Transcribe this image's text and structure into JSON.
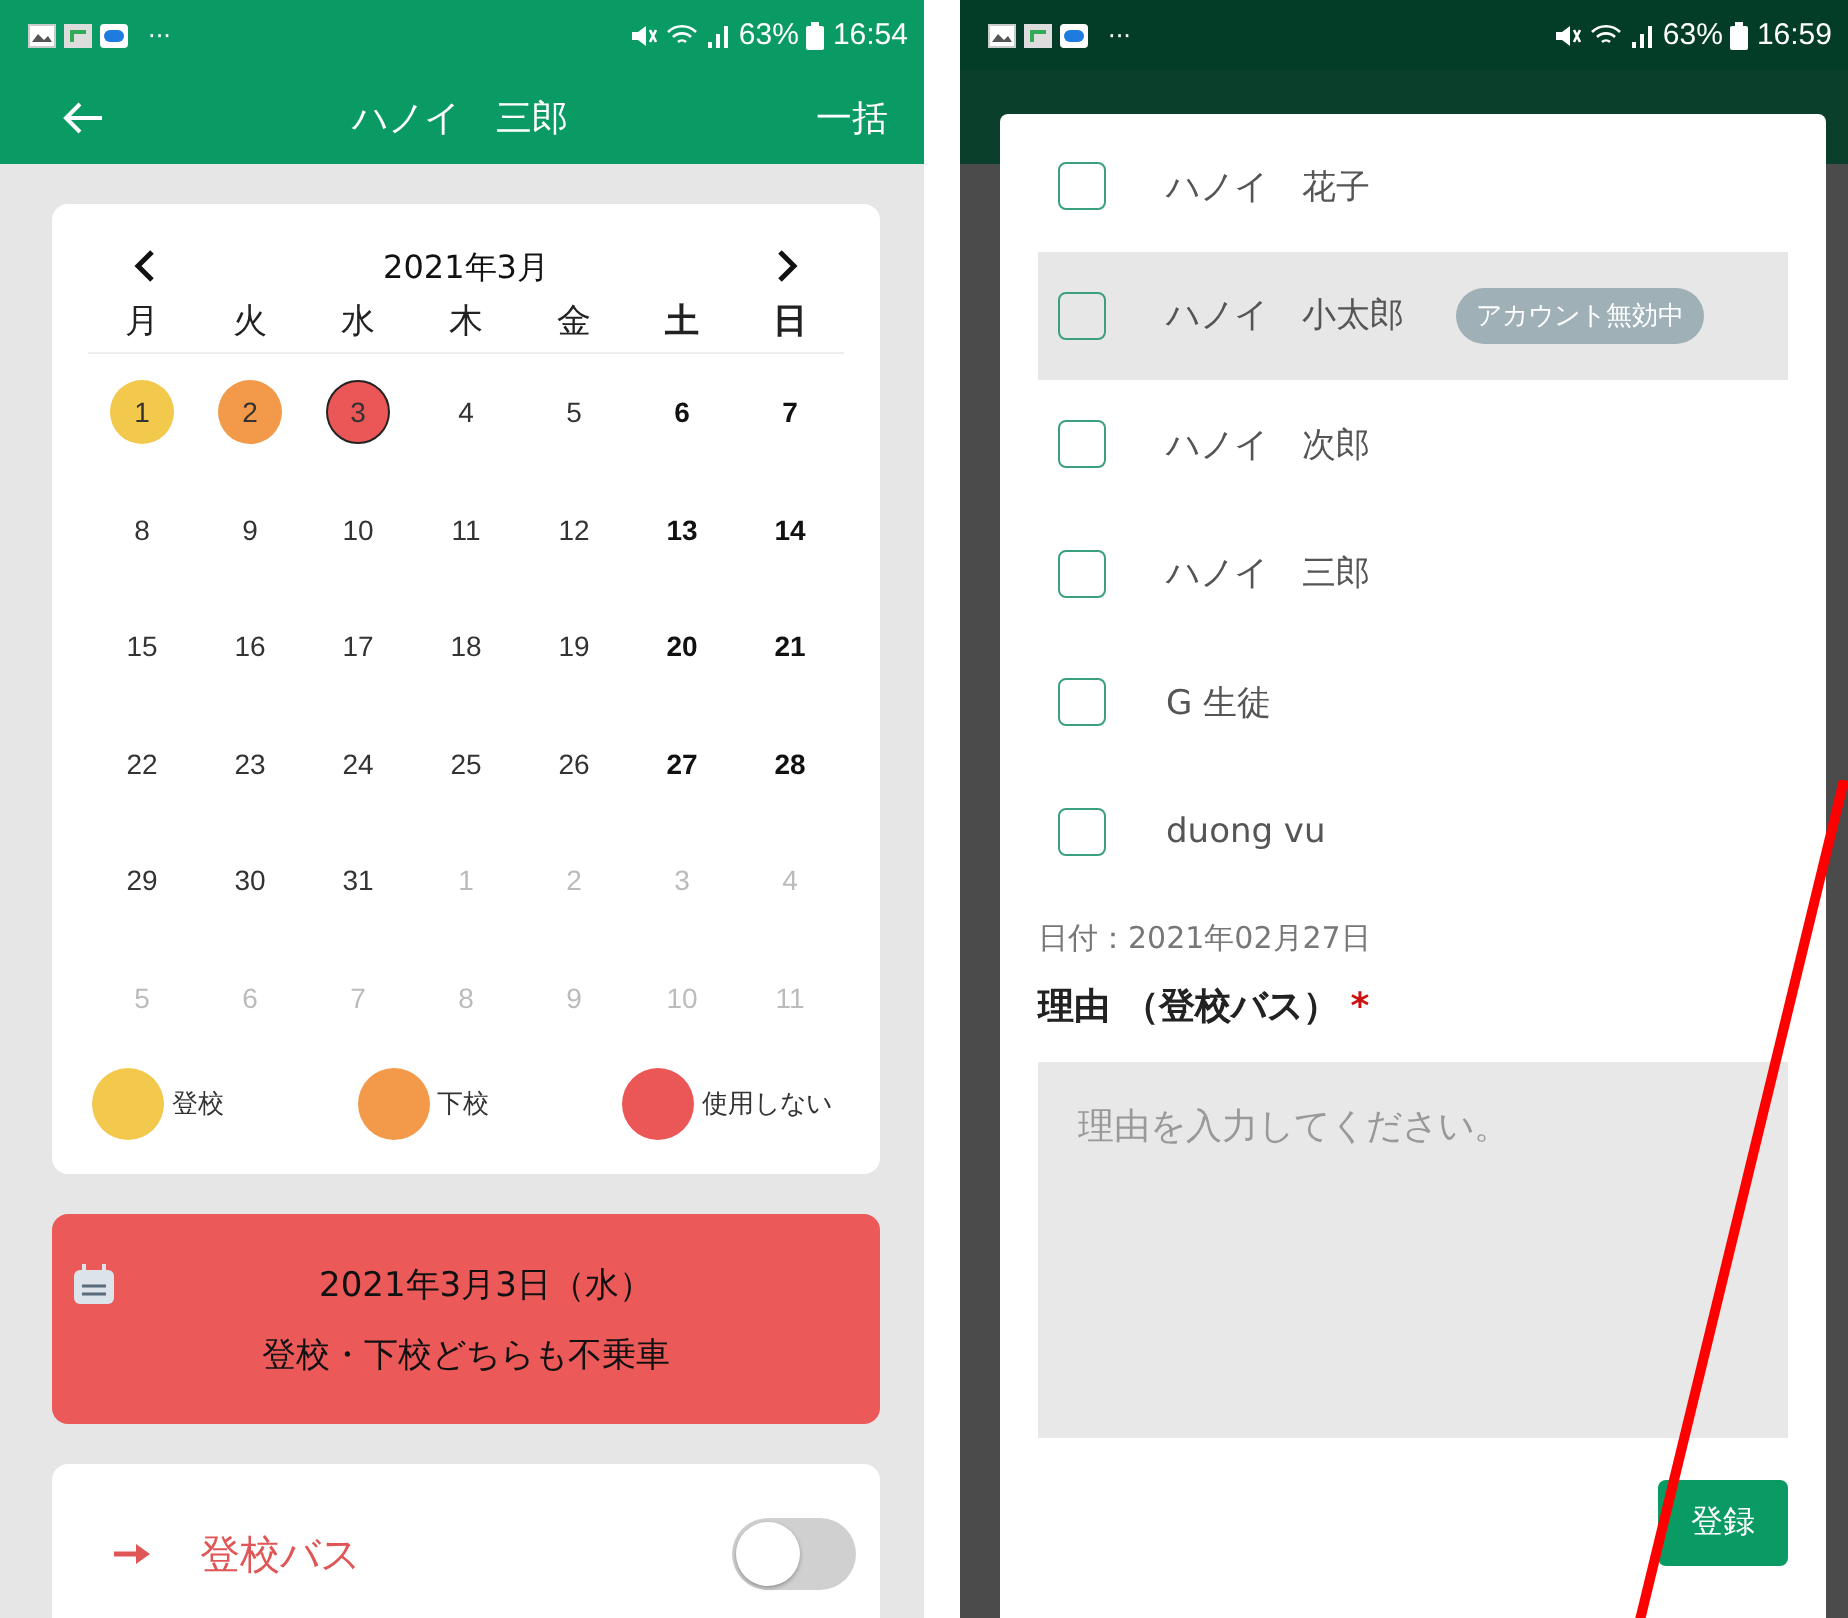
{
  "left_screen": {
    "status_bar": {
      "more": "···",
      "battery": "63%",
      "time": "16:54"
    },
    "header": {
      "title": "ハノイ　三郎",
      "action": "一括"
    },
    "calendar": {
      "month": "2021年3月",
      "weekdays": [
        {
          "label": "月",
          "weekend": false
        },
        {
          "label": "火",
          "weekend": false
        },
        {
          "label": "水",
          "weekend": false
        },
        {
          "label": "木",
          "weekend": false
        },
        {
          "label": "金",
          "weekend": false
        },
        {
          "label": "土",
          "weekend": true
        },
        {
          "label": "日",
          "weekend": true
        }
      ],
      "weeks": [
        [
          {
            "day": "1",
            "in_month": true,
            "weekend": false,
            "color": "#f2c94c",
            "selected": false
          },
          {
            "day": "2",
            "in_month": true,
            "weekend": false,
            "color": "#f2994a",
            "selected": false
          },
          {
            "day": "3",
            "in_month": true,
            "weekend": false,
            "color": "#eb5757",
            "selected": true
          },
          {
            "day": "4",
            "in_month": true,
            "weekend": false,
            "selected": false
          },
          {
            "day": "5",
            "in_month": true,
            "weekend": false,
            "selected": false
          },
          {
            "day": "6",
            "in_month": true,
            "weekend": true,
            "selected": false
          },
          {
            "day": "7",
            "in_month": true,
            "weekend": true,
            "selected": false
          }
        ],
        [
          {
            "day": "8",
            "in_month": true,
            "weekend": false,
            "selected": false
          },
          {
            "day": "9",
            "in_month": true,
            "weekend": false,
            "selected": false
          },
          {
            "day": "10",
            "in_month": true,
            "weekend": false,
            "selected": false
          },
          {
            "day": "11",
            "in_month": true,
            "weekend": false,
            "selected": false
          },
          {
            "day": "12",
            "in_month": true,
            "weekend": false,
            "selected": false
          },
          {
            "day": "13",
            "in_month": true,
            "weekend": true,
            "selected": false
          },
          {
            "day": "14",
            "in_month": true,
            "weekend": true,
            "selected": false
          }
        ],
        [
          {
            "day": "15",
            "in_month": true,
            "weekend": false,
            "selected": false
          },
          {
            "day": "16",
            "in_month": true,
            "weekend": false,
            "selected": false
          },
          {
            "day": "17",
            "in_month": true,
            "weekend": false,
            "selected": false
          },
          {
            "day": "18",
            "in_month": true,
            "weekend": false,
            "selected": false
          },
          {
            "day": "19",
            "in_month": true,
            "weekend": false,
            "selected": false
          },
          {
            "day": "20",
            "in_month": true,
            "weekend": true,
            "selected": false
          },
          {
            "day": "21",
            "in_month": true,
            "weekend": true,
            "selected": false
          }
        ],
        [
          {
            "day": "22",
            "in_month": true,
            "weekend": false,
            "selected": false
          },
          {
            "day": "23",
            "in_month": true,
            "weekend": false,
            "selected": false
          },
          {
            "day": "24",
            "in_month": true,
            "weekend": false,
            "selected": false
          },
          {
            "day": "25",
            "in_month": true,
            "weekend": false,
            "selected": false
          },
          {
            "day": "26",
            "in_month": true,
            "weekend": false,
            "selected": false
          },
          {
            "day": "27",
            "in_month": true,
            "weekend": true,
            "selected": false
          },
          {
            "day": "28",
            "in_month": true,
            "weekend": true,
            "selected": false
          }
        ],
        [
          {
            "day": "29",
            "in_month": true,
            "weekend": false,
            "selected": false
          },
          {
            "day": "30",
            "in_month": true,
            "weekend": false,
            "selected": false
          },
          {
            "day": "31",
            "in_month": true,
            "weekend": false,
            "selected": false
          },
          {
            "day": "1",
            "in_month": false,
            "selected": false
          },
          {
            "day": "2",
            "in_month": false,
            "selected": false
          },
          {
            "day": "3",
            "in_month": false,
            "selected": false
          },
          {
            "day": "4",
            "in_month": false,
            "selected": false
          }
        ],
        [
          {
            "day": "5",
            "in_month": false,
            "selected": false
          },
          {
            "day": "6",
            "in_month": false,
            "selected": false
          },
          {
            "day": "7",
            "in_month": false,
            "selected": false
          },
          {
            "day": "8",
            "in_month": false,
            "selected": false
          },
          {
            "day": "9",
            "in_month": false,
            "selected": false
          },
          {
            "day": "10",
            "in_month": false,
            "selected": false
          },
          {
            "day": "11",
            "in_month": false,
            "selected": false
          }
        ]
      ],
      "legend": [
        {
          "label": "登校",
          "color": "#f2c94c"
        },
        {
          "label": "下校",
          "color": "#f2994a"
        },
        {
          "label": "使用しない",
          "color": "#eb5757"
        }
      ]
    },
    "banner": {
      "date": "2021年3月3日（水）",
      "message": "登校・下校どちらも不乗車"
    },
    "bus": {
      "label": "登校バス",
      "on": false
    }
  },
  "right_screen": {
    "status_bar": {
      "more": "···",
      "battery": "63%",
      "time": "16:59"
    },
    "dialog": {
      "students": [
        {
          "name": "ハノイ　花子",
          "checked": false,
          "disabled": false
        },
        {
          "name": "ハノイ　小太郎",
          "checked": false,
          "disabled": true,
          "badge": "アカウント無効中"
        },
        {
          "name": "ハノイ　次郎",
          "checked": false,
          "disabled": false
        },
        {
          "name": "ハノイ　三郎",
          "checked": false,
          "disabled": false
        },
        {
          "name": "G 生徒",
          "checked": false,
          "disabled": false
        },
        {
          "name": "duong vu",
          "checked": false,
          "disabled": false
        }
      ],
      "date": "日付：2021年02月27日",
      "reason_label": "理由 （登校バス）",
      "required_mark": "*",
      "reason_placeholder": "理由を入力してください。",
      "submit": "登録"
    }
  }
}
